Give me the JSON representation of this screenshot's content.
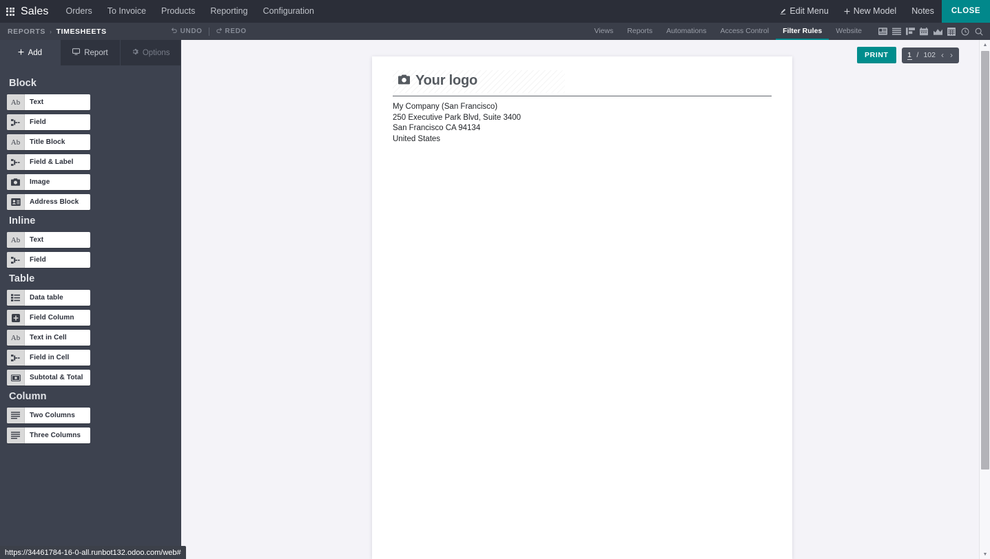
{
  "navbar": {
    "apps_icon": "apps-grid-icon",
    "brand": "Sales",
    "menus": [
      {
        "label": "Orders"
      },
      {
        "label": "To Invoice"
      },
      {
        "label": "Products"
      },
      {
        "label": "Reporting"
      },
      {
        "label": "Configuration"
      }
    ],
    "right": {
      "edit_menu": "Edit Menu",
      "edit_menu_icon": "pencil-icon",
      "new_model": "New Model",
      "new_model_icon": "plus-icon",
      "notes": "Notes",
      "close": "CLOSE",
      "close_color": "#01888b"
    }
  },
  "subbar": {
    "breadcrumb": {
      "parent": "REPORTS",
      "separator": "›",
      "current": "TIMESHEETS"
    },
    "undo": {
      "label": "UNDO",
      "icon": "undo-arrow-icon"
    },
    "redo": {
      "label": "REDO",
      "icon": "redo-arrow-icon"
    },
    "tabs": [
      {
        "label": "Views",
        "active": false
      },
      {
        "label": "Reports",
        "active": false
      },
      {
        "label": "Automations",
        "active": false
      },
      {
        "label": "Access Control",
        "active": false
      },
      {
        "label": "Filter Rules",
        "active": true
      },
      {
        "label": "Website",
        "active": false
      }
    ],
    "active_tab_color": "#01888b",
    "view_icons": [
      {
        "name": "kanban-card-icon"
      },
      {
        "name": "list-view-icon"
      },
      {
        "name": "gantt-view-icon"
      },
      {
        "name": "calendar-view-icon"
      },
      {
        "name": "graph-view-icon"
      },
      {
        "name": "pivot-view-icon"
      },
      {
        "name": "activity-clock-icon"
      },
      {
        "name": "search-icon"
      }
    ]
  },
  "sidebar": {
    "tabs": [
      {
        "label": "Add",
        "icon": "plus-icon",
        "state": "active"
      },
      {
        "label": "Report",
        "icon": "monitor-icon",
        "state": "normal"
      },
      {
        "label": "Options",
        "icon": "gear-icon",
        "state": "disabled"
      }
    ],
    "sections": [
      {
        "title": "Block",
        "items": [
          {
            "label": "Text",
            "icon": "ab-text-icon"
          },
          {
            "label": "Field",
            "icon": "field-tag-icon"
          },
          {
            "label": "Title Block",
            "icon": "ab-text-icon"
          },
          {
            "label": "Field & Label",
            "icon": "field-tag-icon"
          },
          {
            "label": "Image",
            "icon": "camera-icon"
          },
          {
            "label": "Address Block",
            "icon": "address-card-icon"
          }
        ]
      },
      {
        "title": "Inline",
        "items": [
          {
            "label": "Text",
            "icon": "ab-text-icon"
          },
          {
            "label": "Field",
            "icon": "field-tag-icon"
          }
        ]
      },
      {
        "title": "Table",
        "items": [
          {
            "label": "Data table",
            "icon": "data-table-icon"
          },
          {
            "label": "Field Column",
            "icon": "plus-square-icon"
          },
          {
            "label": "Text in Cell",
            "icon": "ab-text-icon"
          },
          {
            "label": "Field in Cell",
            "icon": "field-tag-icon"
          },
          {
            "label": "Subtotal & Total",
            "icon": "money-icon"
          }
        ]
      },
      {
        "title": "Column",
        "items": [
          {
            "label": "Two Columns",
            "icon": "two-columns-icon"
          },
          {
            "label": "Three Columns",
            "icon": "three-columns-icon"
          }
        ]
      }
    ]
  },
  "document": {
    "logo_placeholder": "Your logo",
    "logo_icon": "camera-icon",
    "address_lines": [
      "My Company (San Francisco)",
      "250 Executive Park Blvd, Suite 3400",
      "San Francisco CA 94134",
      "United States"
    ]
  },
  "controls": {
    "print_label": "PRINT",
    "print_color": "#018d8d",
    "page_current": "1",
    "page_separator": "/",
    "page_total": "102",
    "prev_icon": "chevron-left-icon",
    "next_icon": "chevron-right-icon"
  },
  "statusbar": {
    "url": "https://34461784-16-0-all.runbot132.odoo.com/web#"
  }
}
